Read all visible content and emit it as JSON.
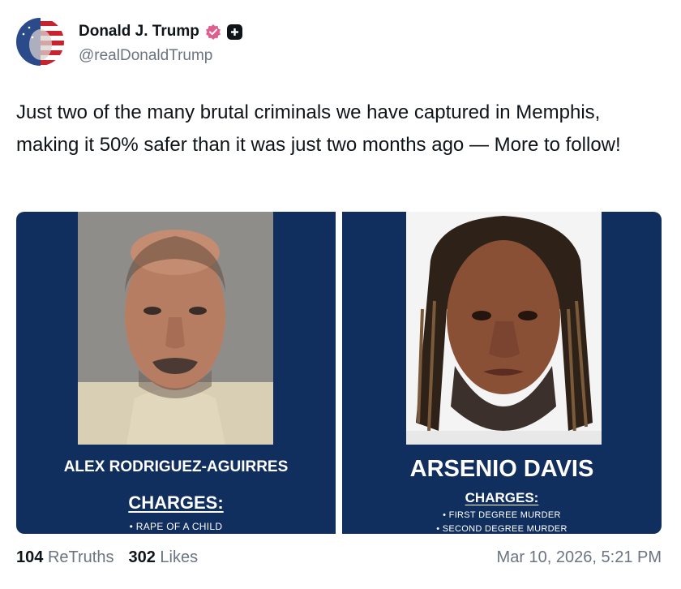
{
  "author": {
    "display_name": "Donald J. Trump",
    "handle": "@realDonaldTrump",
    "avatar_icon": "flag-avatar-icon",
    "verified_icon": "verified-badge-icon",
    "plus_icon": "plus-badge-icon",
    "verified_color": "#e05d8f"
  },
  "post": {
    "text": "Just two of the many brutal criminals we have captured in Memphis, making it 50% safer than it was just two months ago — More to follow!"
  },
  "media": {
    "background_color": "#102f5e",
    "cards": [
      {
        "name": "ALEX RODRIGUEZ-AGUIRRES",
        "charges_heading": "CHARGES:",
        "charges": [
          "• RAPE OF A CHILD"
        ],
        "photo_icon": "mugshot-photo"
      },
      {
        "name": "ARSENIO DAVIS",
        "charges_heading": "CHARGES:",
        "charges": [
          "• FIRST DEGREE MURDER",
          "• SECOND DEGREE MURDER"
        ],
        "photo_icon": "mugshot-photo"
      }
    ]
  },
  "stats": {
    "retruths_count": "104",
    "retruths_label": "ReTruths",
    "likes_count": "302",
    "likes_label": "Likes"
  },
  "timestamp": "Mar 10, 2026, 5:21 PM"
}
